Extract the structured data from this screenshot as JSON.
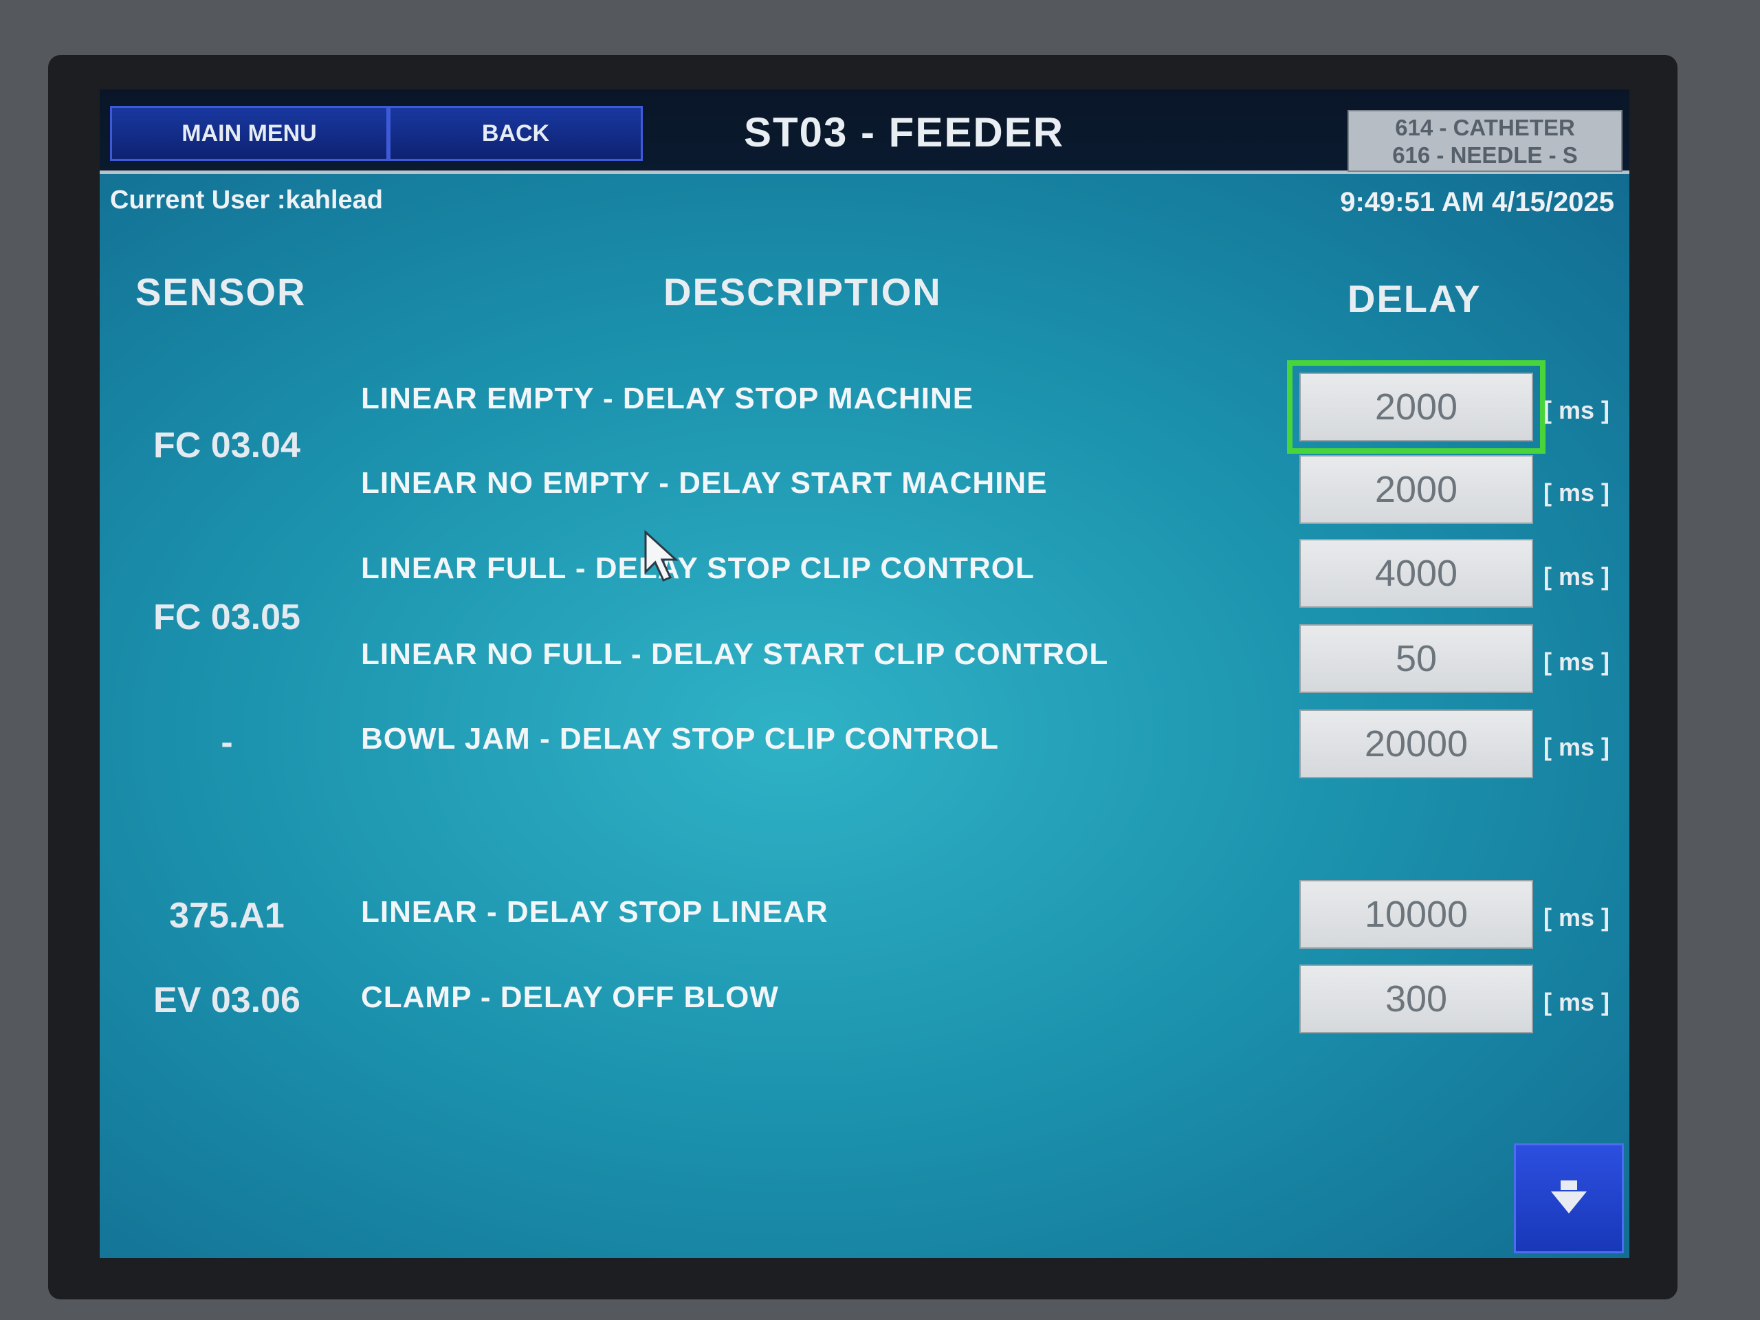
{
  "header": {
    "main_menu_label": "MAIN MENU",
    "back_label": "BACK",
    "title": "ST03 - FEEDER",
    "mode_line1": "614 - CATHETER",
    "mode_line2": "616 - NEEDLE - S"
  },
  "status": {
    "current_user": "Current User :kahlead",
    "datetime": "9:49:51 AM 4/15/2025"
  },
  "columns": {
    "sensor": "SENSOR",
    "description": "DESCRIPTION",
    "delay": "DELAY"
  },
  "sensors": [
    "FC 03.04",
    "FC 03.05",
    "-",
    "375.A1",
    "EV 03.06"
  ],
  "rows": [
    {
      "description": "LINEAR EMPTY - DELAY STOP MACHINE",
      "value": "2000",
      "unit": "[ ms ]",
      "selected": true
    },
    {
      "description": "LINEAR NO EMPTY - DELAY START MACHINE",
      "value": "2000",
      "unit": "[ ms ]"
    },
    {
      "description": "LINEAR FULL - DELAY STOP CLIP CONTROL",
      "value": "4000",
      "unit": "[ ms ]"
    },
    {
      "description": "LINEAR NO FULL - DELAY START CLIP CONTROL",
      "value": "50",
      "unit": "[ ms ]"
    },
    {
      "description": "BOWL JAM - DELAY STOP CLIP CONTROL",
      "value": "20000",
      "unit": "[ ms ]"
    },
    {
      "description": "LINEAR - DELAY STOP LINEAR",
      "value": "10000",
      "unit": "[ ms ]"
    },
    {
      "description": "CLAMP - DELAY OFF BLOW",
      "value": "300",
      "unit": "[ ms ]"
    }
  ],
  "icons": {
    "page_down": "chevron-down-icon",
    "pointer": "mouse-cursor-icon"
  },
  "colors": {
    "selection": "#49d53a",
    "nav_button": "#1838a0"
  }
}
